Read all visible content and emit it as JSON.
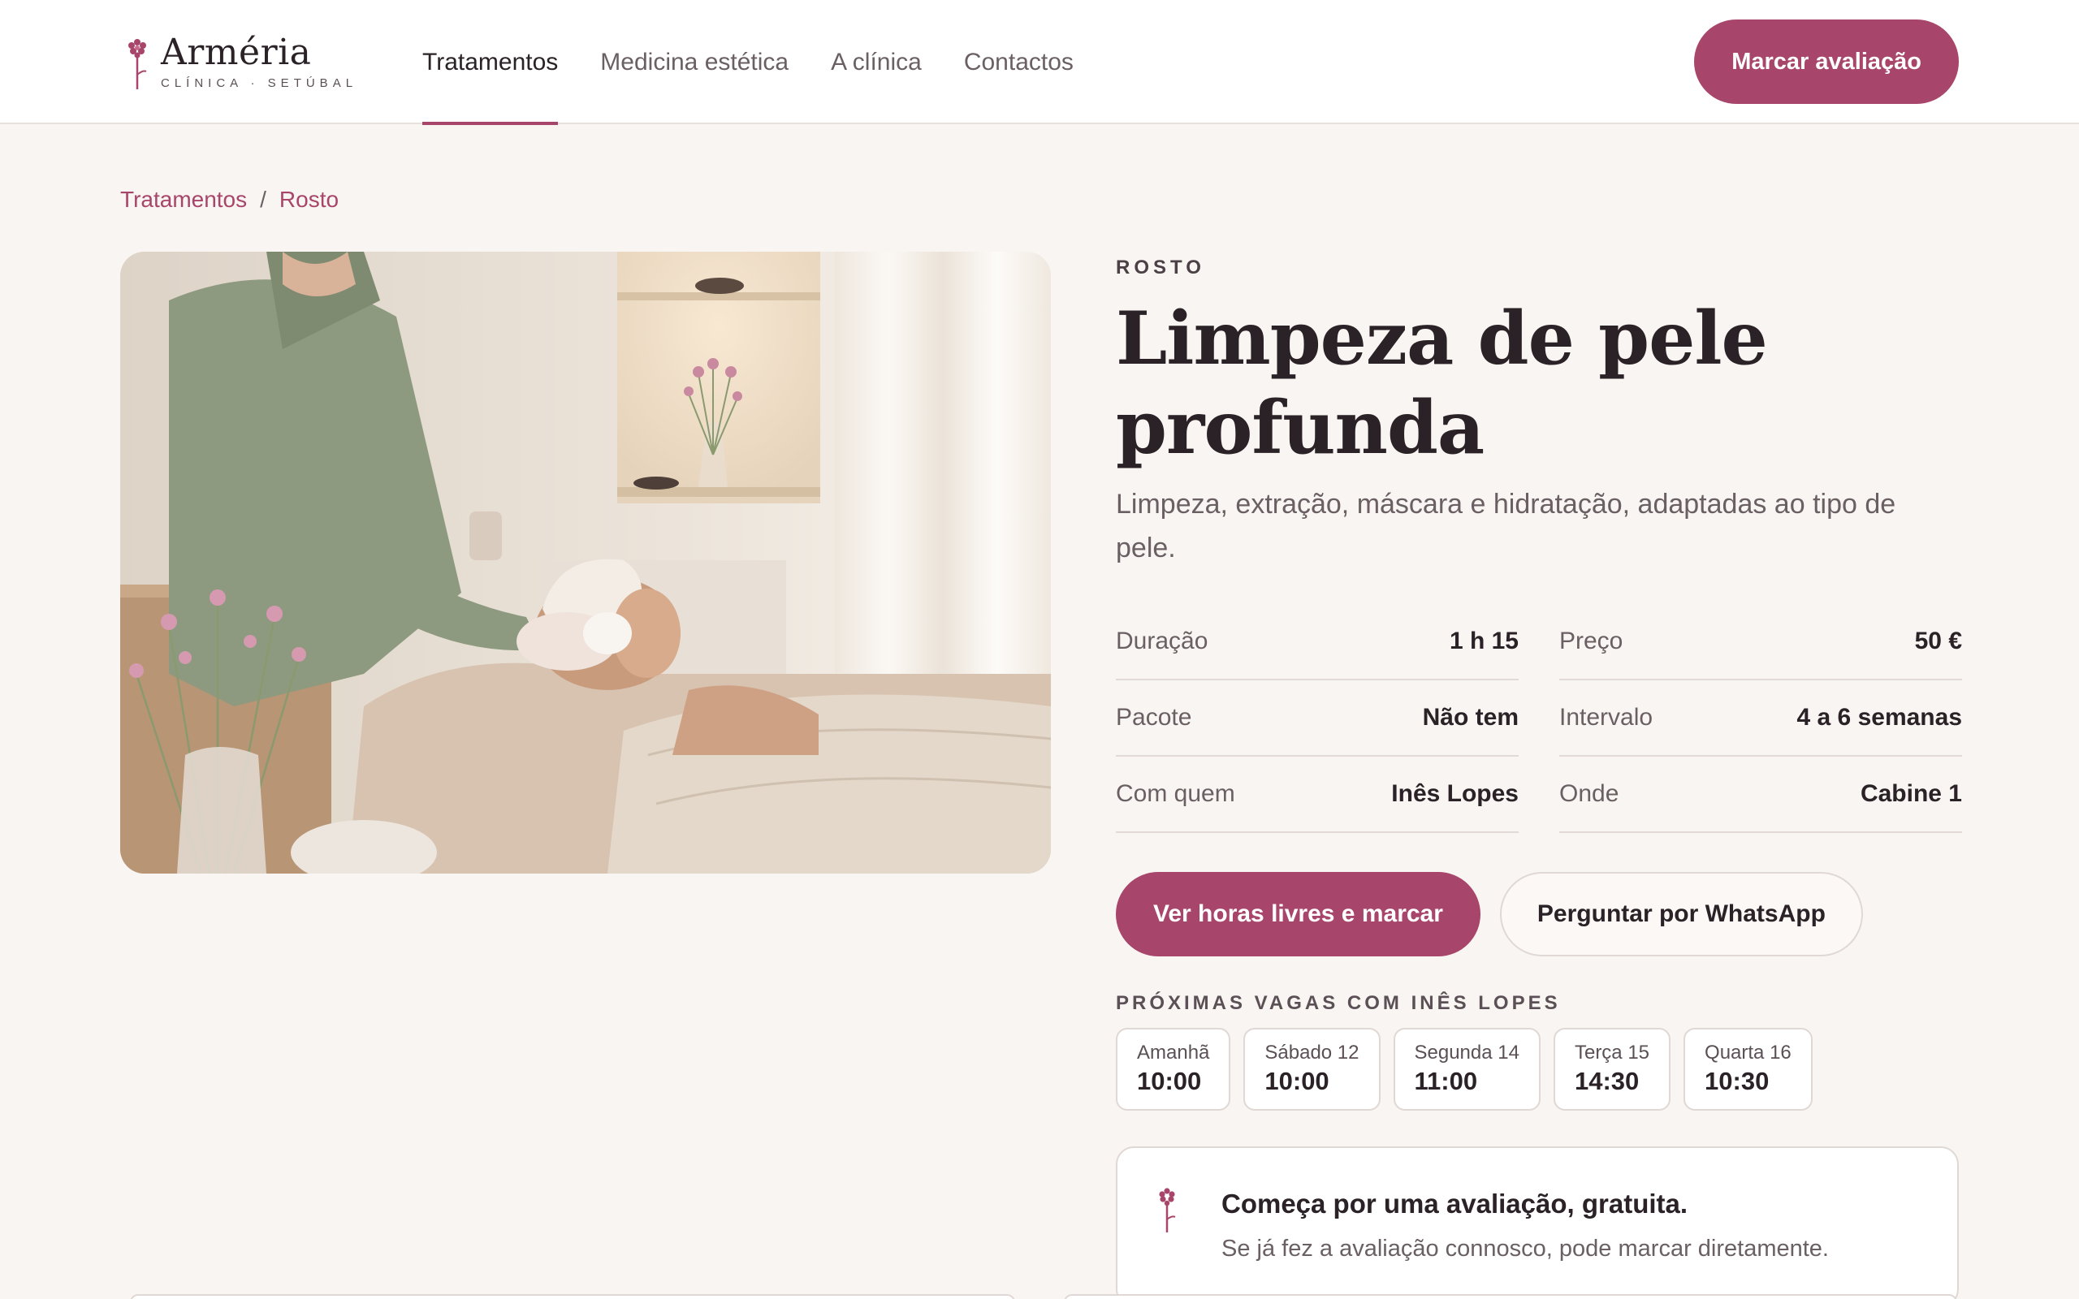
{
  "brand": {
    "name": "Arméria",
    "subtitle": "CLÍNICA · SETÚBAL",
    "accent": "#a8456a"
  },
  "nav": {
    "items": [
      {
        "label": "Tratamentos",
        "active": true
      },
      {
        "label": "Medicina estética",
        "active": false
      },
      {
        "label": "A clínica",
        "active": false
      },
      {
        "label": "Contactos",
        "active": false
      }
    ],
    "cta": "Marcar avaliação"
  },
  "breadcrumb": {
    "items": [
      "Tratamentos",
      "Rosto"
    ],
    "separator": "/"
  },
  "treatment": {
    "category": "ROSTO",
    "title": "Limpeza de pele profunda",
    "description": "Limpeza, extração, máscara e hidratação, adaptadas ao tipo de pele.",
    "facts": [
      {
        "label": "Duração",
        "value": "1 h 15"
      },
      {
        "label": "Preço",
        "value": "50 €"
      },
      {
        "label": "Pacote",
        "value": "Não tem"
      },
      {
        "label": "Intervalo",
        "value": "4 a 6 semanas"
      },
      {
        "label": "Com quem",
        "value": "Inês Lopes"
      },
      {
        "label": "Onde",
        "value": "Cabine 1"
      }
    ],
    "primary_button": "Ver horas livres e marcar",
    "secondary_button": "Perguntar por WhatsApp"
  },
  "slots": {
    "title": "PRÓXIMAS VAGAS COM INÊS LOPES",
    "items": [
      {
        "day": "Amanhã",
        "time": "10:00"
      },
      {
        "day": "Sábado 12",
        "time": "10:00"
      },
      {
        "day": "Segunda 14",
        "time": "11:00"
      },
      {
        "day": "Terça 15",
        "time": "14:30"
      },
      {
        "day": "Quarta 16",
        "time": "10:30"
      }
    ]
  },
  "note": {
    "icon": "flower-icon",
    "title": "Começa por uma avaliação, gratuita.",
    "text": "Se já fez a avaliação connosco, pode marcar diretamente."
  }
}
